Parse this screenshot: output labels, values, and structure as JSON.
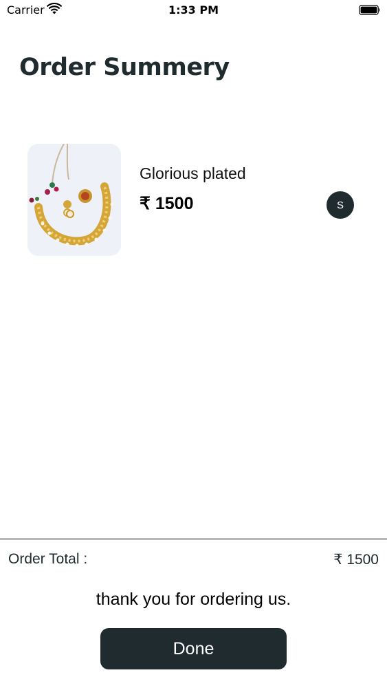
{
  "status_bar": {
    "carrier": "Carrier",
    "time": "1:33 PM",
    "wifi_icon": "wifi-icon",
    "battery_icon": "battery-icon"
  },
  "header": {
    "title": "Order Summery"
  },
  "order_items": [
    {
      "name": "Glorious plated",
      "price": "₹ 1500",
      "size": "S",
      "image": "gold-necklace-jewellery-set"
    }
  ],
  "footer": {
    "total_label": "Order Total :",
    "total_value": "₹ 1500",
    "thank_you": "thank you for ordering us.",
    "done_label": "Done"
  },
  "colors": {
    "primary_dark": "#1f2b2e",
    "divider": "#b9b9b9",
    "image_bg": "#eef2f8"
  }
}
